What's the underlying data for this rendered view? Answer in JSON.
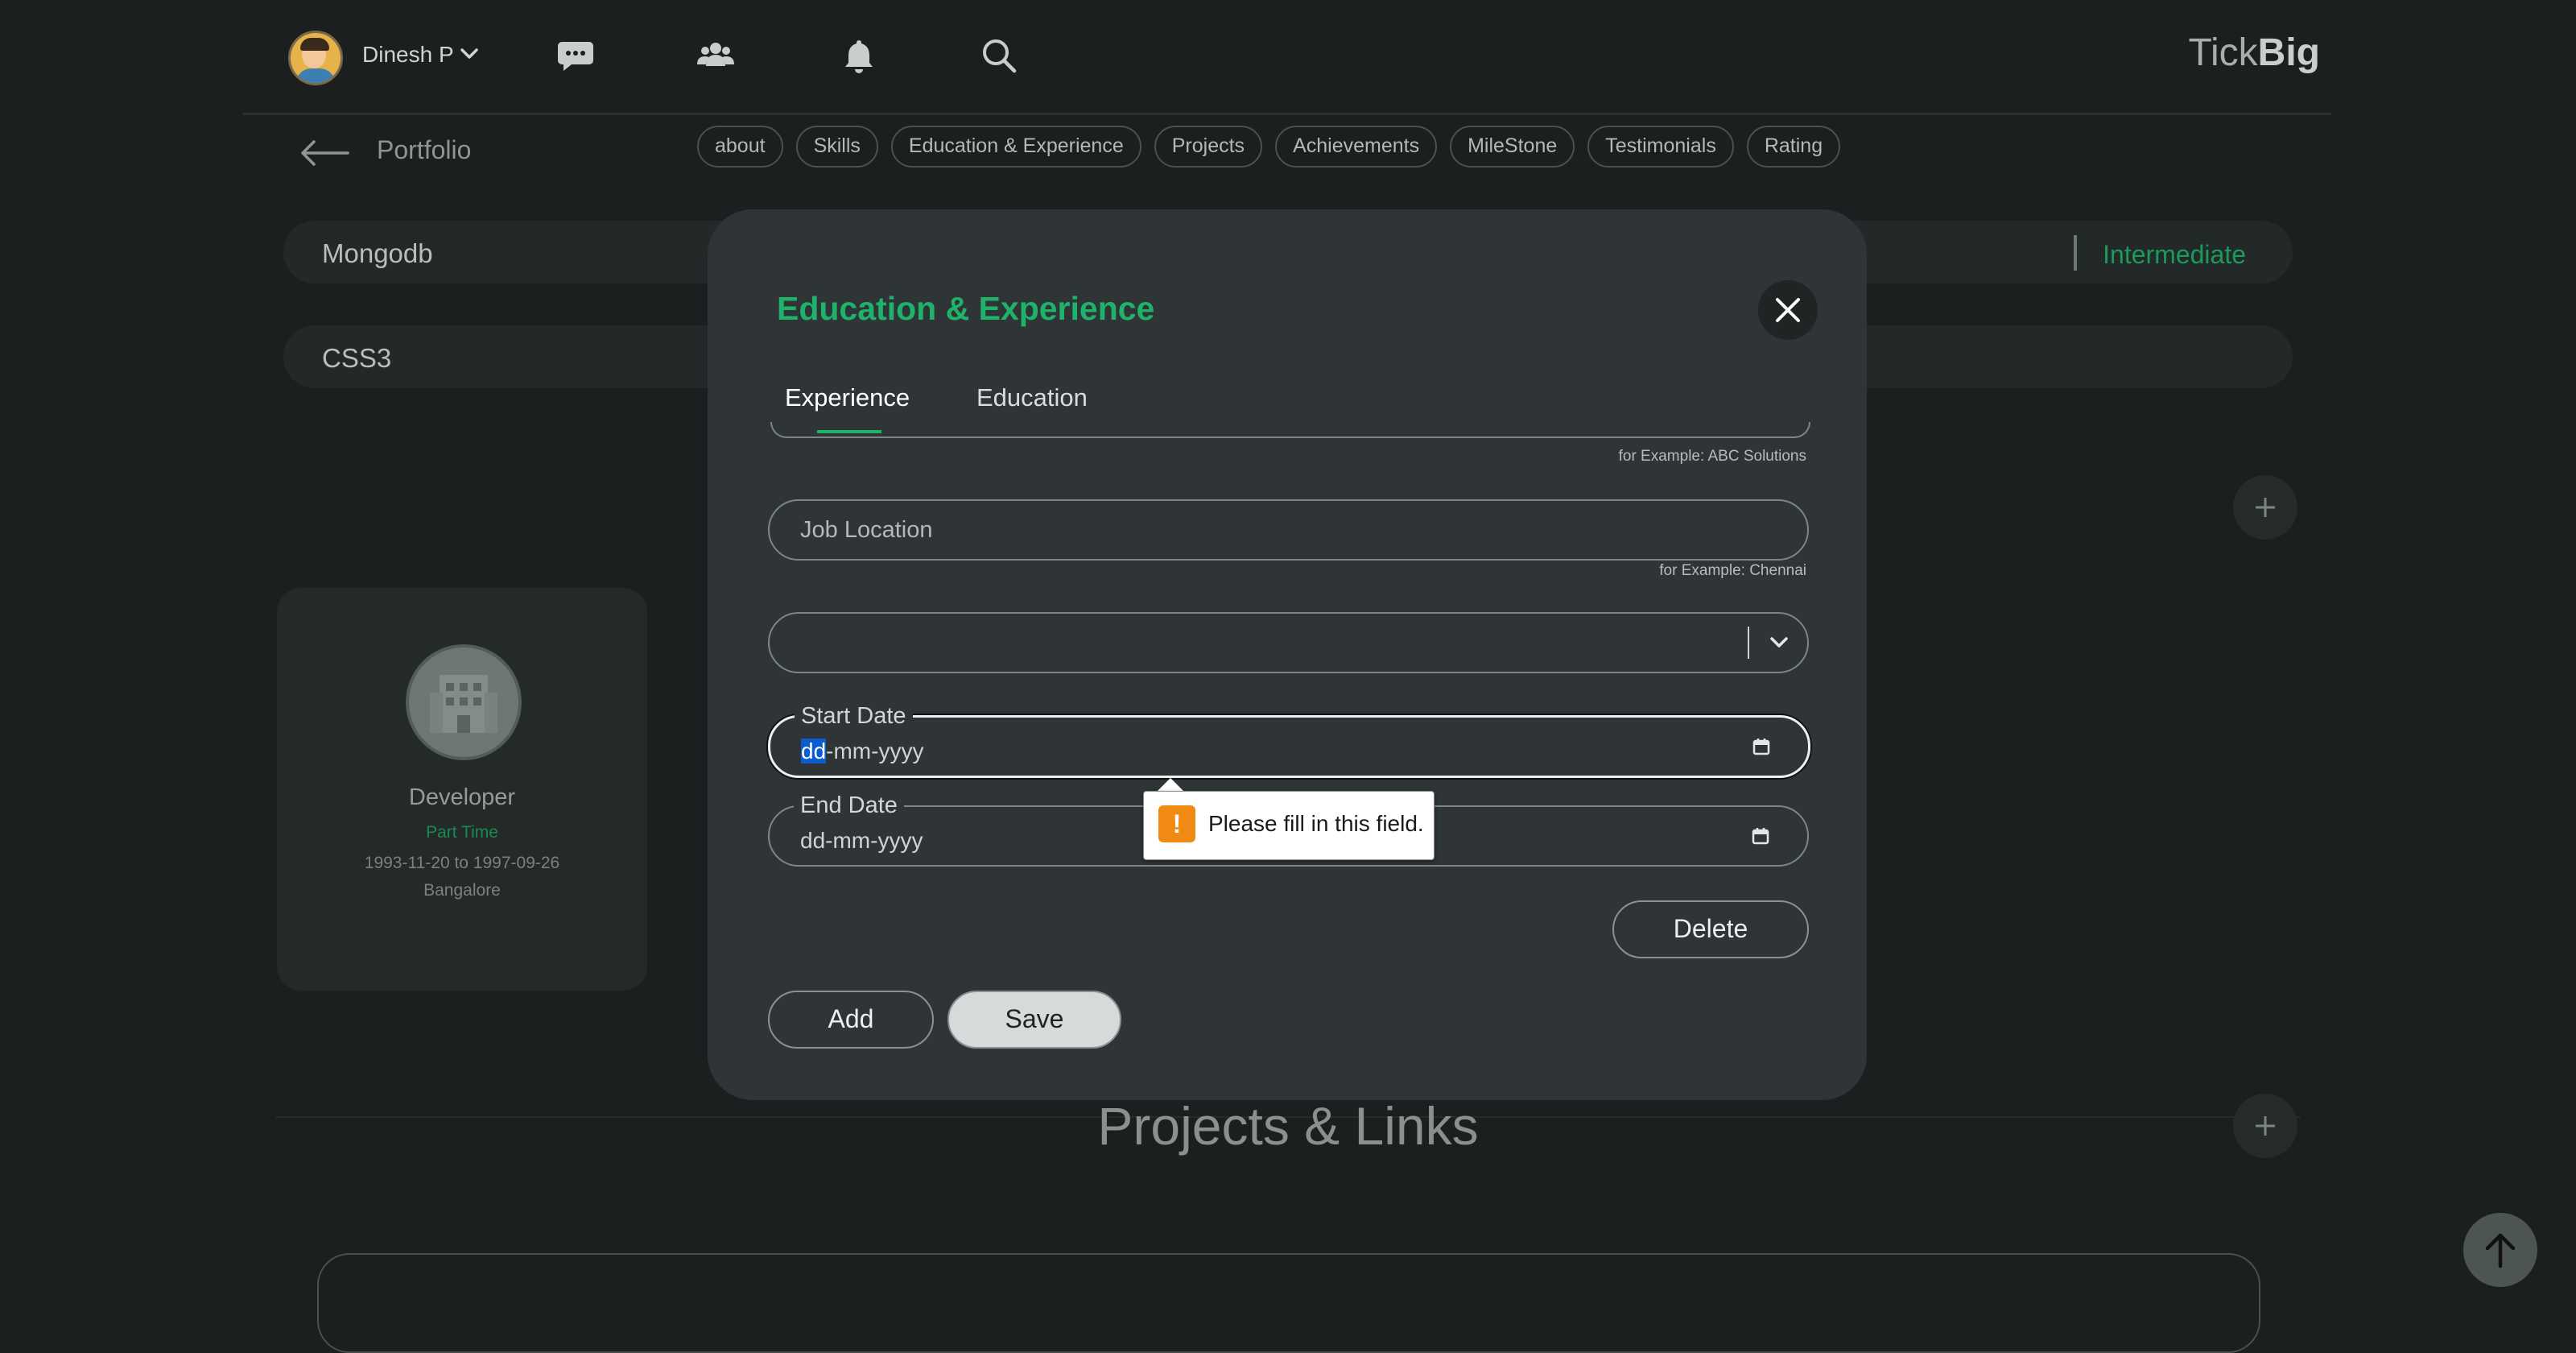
{
  "header": {
    "user_name": "Dinesh P",
    "brand_prefix": "Tick",
    "brand_suffix": "Big",
    "icons": [
      "chat-icon",
      "people-icon",
      "bell-icon",
      "search-icon"
    ]
  },
  "subheader": {
    "title": "Portfolio",
    "chips": [
      "about",
      "Skills",
      "Education & Experience",
      "Projects",
      "Achievements",
      "MileStone",
      "Testimonials",
      "Rating"
    ]
  },
  "skills": [
    {
      "name": "Mongodb",
      "level": "Intermediate"
    },
    {
      "name": "CSS3",
      "level": ""
    }
  ],
  "experience_card": {
    "role": "Developer",
    "type": "Part Time",
    "dates": "1993-11-20 to 1997-09-26",
    "location": "Bangalore"
  },
  "projects_section": {
    "title": "Projects & Links"
  },
  "modal": {
    "title": "Education & Experience",
    "tabs": [
      "Experience",
      "Education"
    ],
    "active_tab": "Experience",
    "company_helper": "for Example: ABC Solutions",
    "location_field": {
      "placeholder": "Job Location",
      "helper": "for Example: Chennai"
    },
    "job_type_select": {
      "value": ""
    },
    "start_date": {
      "label": "Start Date",
      "segment_selected": "dd",
      "rest": "-mm-yyyy"
    },
    "end_date": {
      "label": "End Date",
      "value": "dd-mm-yyyy"
    },
    "delete_label": "Delete",
    "add_label": "Add",
    "save_label": "Save"
  },
  "tooltip": {
    "message": "Please fill in this field."
  },
  "colors": {
    "accent": "#1fb26a",
    "background": "#1b1f1f",
    "modal": "#2f3536",
    "warning": "#f08a12"
  }
}
